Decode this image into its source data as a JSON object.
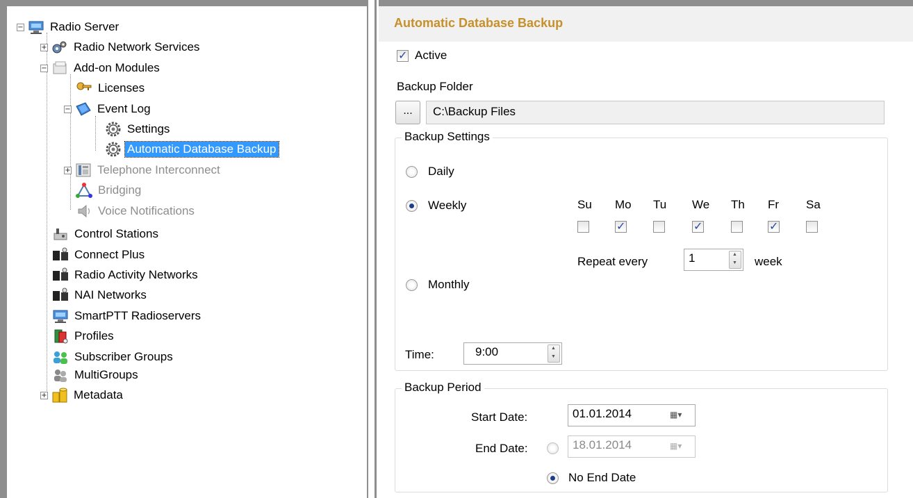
{
  "tree": {
    "items": [
      {
        "label": "Radio Server",
        "state": "normal",
        "icon": "server-icon"
      },
      {
        "label": "Radio Network Services",
        "state": "normal",
        "icon": "gears-icon"
      },
      {
        "label": "Add-on Modules",
        "state": "normal",
        "icon": "modules-icon"
      },
      {
        "label": "Licenses",
        "state": "normal",
        "icon": "key-icon"
      },
      {
        "label": "Event Log",
        "state": "normal",
        "icon": "log-book-icon"
      },
      {
        "label": "Settings",
        "state": "normal",
        "icon": "gear-icon"
      },
      {
        "label": "Automatic Database Backup",
        "state": "selected",
        "icon": "gear-icon"
      },
      {
        "label": "Telephone Interconnect",
        "state": "disabled",
        "icon": "telephone-icon"
      },
      {
        "label": "Bridging",
        "state": "disabled",
        "icon": "bridge-icon"
      },
      {
        "label": "Voice Notifications",
        "state": "disabled",
        "icon": "speaker-icon"
      },
      {
        "label": "Control Stations",
        "state": "normal",
        "icon": "radio-icon"
      },
      {
        "label": "Connect Plus",
        "state": "normal",
        "icon": "network-icon"
      },
      {
        "label": "Radio Activity Networks",
        "state": "normal",
        "icon": "network-icon"
      },
      {
        "label": "NAI Networks",
        "state": "normal",
        "icon": "network-icon"
      },
      {
        "label": "SmartPTT Radioservers",
        "state": "normal",
        "icon": "server-icon"
      },
      {
        "label": "Profiles",
        "state": "normal",
        "icon": "profiles-icon"
      },
      {
        "label": "Subscriber Groups",
        "state": "normal",
        "icon": "users-icon"
      },
      {
        "label": "MultiGroups",
        "state": "normal",
        "icon": "multigroup-icon"
      },
      {
        "label": "Metadata",
        "state": "normal",
        "icon": "database-icon"
      }
    ]
  },
  "panel": {
    "title": "Automatic Database Backup",
    "active_label": "Active",
    "active_checked": true,
    "backup_folder_label": "Backup Folder",
    "browse_label": "...",
    "folder_path": "C:\\Backup Files",
    "backup_settings": {
      "legend": "Backup Settings",
      "daily_label": "Daily",
      "weekly_label": "Weekly",
      "monthly_label": "Monthly",
      "selected": "Weekly",
      "days": [
        {
          "label": "Su",
          "checked": false
        },
        {
          "label": "Mo",
          "checked": true
        },
        {
          "label": "Tu",
          "checked": false
        },
        {
          "label": "We",
          "checked": true
        },
        {
          "label": "Th",
          "checked": false
        },
        {
          "label": "Fr",
          "checked": true
        },
        {
          "label": "Sa",
          "checked": false
        }
      ],
      "repeat_label": "Repeat every",
      "repeat_value": "1",
      "repeat_unit": "week",
      "time_label": "Time:",
      "time_value": "9:00"
    },
    "backup_period": {
      "legend": "Backup Period",
      "start_label": "Start Date:",
      "start_value": "01.01.2014",
      "end_label": "End Date:",
      "end_value": "18.01.2014",
      "no_end_label": "No End Date",
      "no_end_selected": true
    }
  },
  "colors": {
    "title": "#c7902a",
    "selection": "#3399ff",
    "header_bg": "#f1f1f1"
  }
}
